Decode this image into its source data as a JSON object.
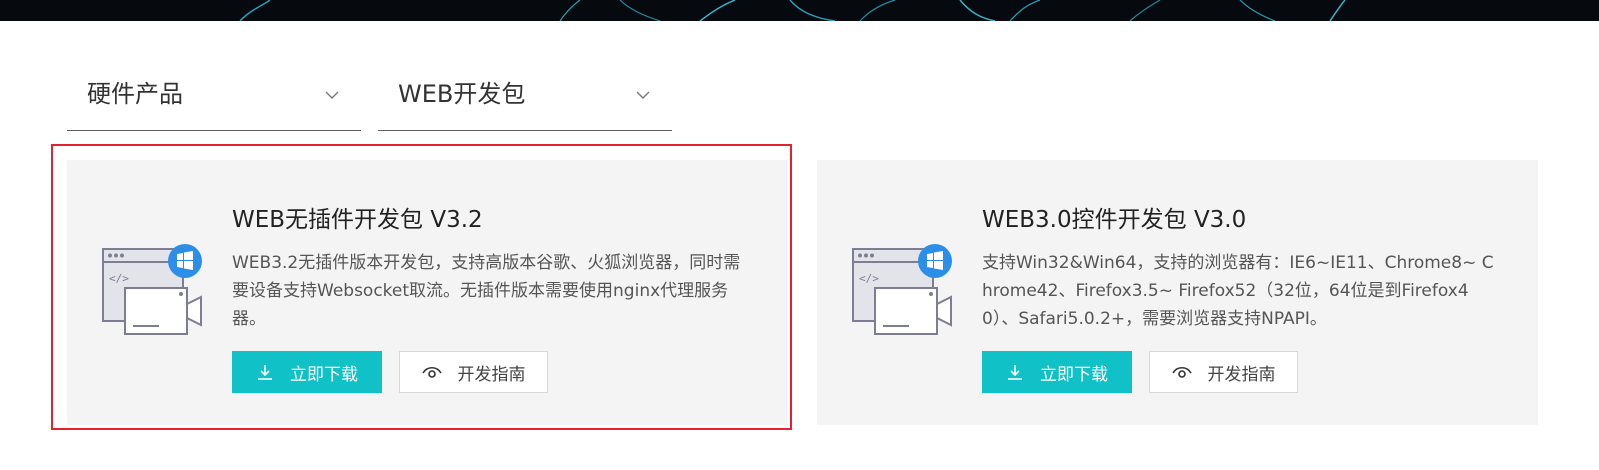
{
  "filters": {
    "product": "硬件产品",
    "category": "WEB开发包"
  },
  "cards": [
    {
      "title": "WEB无插件开发包 V3.2",
      "description": "WEB3.2无插件版本开发包，支持高版本谷歌、火狐浏览器，同时需要设备支持Websocket取流。无插件版本需要使用nginx代理服务器。",
      "download_label": "立即下载",
      "guide_label": "开发指南",
      "highlighted": true
    },
    {
      "title": "WEB3.0控件开发包 V3.0",
      "description": "支持Win32&Win64，支持的浏览器有：IE6~IE11、Chrome8~ Chrome42、Firefox3.5~ Firefox52（32位，64位是到Firefox40）、Safari5.0.2+，需要浏览器支持NPAPI。",
      "download_label": "立即下载",
      "guide_label": "开发指南",
      "highlighted": false
    }
  ],
  "icons": {
    "select_chevron": "chevron-down-icon",
    "card_icon": "web-video-windows-icon",
    "download": "download-icon",
    "guide": "eye-icon"
  },
  "colors": {
    "accent": "#10c1c8",
    "highlight_border": "#e4212e",
    "card_bg": "#f4f4f4",
    "banner_bg": "#06090d"
  }
}
